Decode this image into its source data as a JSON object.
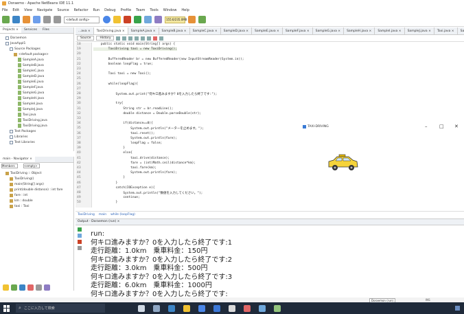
{
  "window": {
    "title": "Doraemo - Apache NetBeans IDE 11.1"
  },
  "menu": [
    "File",
    "Edit",
    "View",
    "Navigate",
    "Source",
    "Refactor",
    "Run",
    "Debug",
    "Profile",
    "Team",
    "Tools",
    "Window",
    "Help"
  ],
  "toolbar": {
    "config": "<default config>",
    "memory": "155.6/235.0MB"
  },
  "projects_panel": {
    "tabs": [
      "Projects ×",
      "Services",
      "Files"
    ],
    "tree": [
      {
        "label": "Doraemon",
        "indent": 1,
        "kind": "box"
      },
      {
        "label": "JavaAppl1",
        "indent": 1,
        "kind": "box"
      },
      {
        "label": "Source Packages",
        "indent": 2,
        "kind": "box"
      },
      {
        "label": "<default package>",
        "indent": 3,
        "kind": "pkg"
      },
      {
        "label": "SampleA.java",
        "indent": 4,
        "kind": "file"
      },
      {
        "label": "SampleB.java",
        "indent": 4,
        "kind": "file"
      },
      {
        "label": "SampleC.java",
        "indent": 4,
        "kind": "file"
      },
      {
        "label": "SampleD.java",
        "indent": 4,
        "kind": "file"
      },
      {
        "label": "SampleE.java",
        "indent": 4,
        "kind": "file"
      },
      {
        "label": "SampleF.java",
        "indent": 4,
        "kind": "file"
      },
      {
        "label": "SampleG.java",
        "indent": 4,
        "kind": "file"
      },
      {
        "label": "SampleH.java",
        "indent": 4,
        "kind": "file"
      },
      {
        "label": "SampleI.java",
        "indent": 4,
        "kind": "file"
      },
      {
        "label": "SampleJ.java",
        "indent": 4,
        "kind": "file"
      },
      {
        "label": "Taxi.java",
        "indent": 4,
        "kind": "file"
      },
      {
        "label": "TaxiDriving.java",
        "indent": 4,
        "kind": "file"
      },
      {
        "label": "TaxiDriving.java",
        "indent": 4,
        "kind": "file"
      },
      {
        "label": "Test Packages",
        "indent": 2,
        "kind": "box"
      },
      {
        "label": "Libraries",
        "indent": 2,
        "kind": "box"
      },
      {
        "label": "Test Libraries",
        "indent": 2,
        "kind": "box"
      }
    ]
  },
  "navigator_panel": {
    "title": "main - Navigator ×",
    "members_label": "Members",
    "filter": "<empty>",
    "items": [
      {
        "label": "TaxiDriving :: Object",
        "indent": 1
      },
      {
        "label": "TaxiDriving()",
        "indent": 2
      },
      {
        "label": "main(String[] args)",
        "indent": 2
      },
      {
        "label": "print(double distance) : int fare",
        "indent": 2
      },
      {
        "label": "fare : int",
        "indent": 2
      },
      {
        "label": "km : double",
        "indent": 2
      },
      {
        "label": "taxi : Taxi",
        "indent": 2
      }
    ]
  },
  "editor": {
    "tabs": [
      "...ava ×",
      "TaxiDriving.java ×",
      "SampleA.java ×",
      "SampleB.java ×",
      "SampleC.java ×",
      "SampleD.java ×",
      "SampleE.java ×",
      "SampleF.java ×",
      "SampleG.java ×",
      "SampleH.java ×",
      "SampleI.java ×",
      "SampleJ.java ×",
      "Taxi.java ×",
      "SampleK.java ×",
      "Sample"
    ],
    "source_btn": "Source",
    "history_btn": "History",
    "line_numbers": [
      "18",
      "19",
      "20",
      "21",
      "22",
      "23",
      "24",
      "25",
      "26",
      "27",
      "28",
      "29",
      "30",
      "31",
      "32",
      "33",
      "34",
      "35",
      "36",
      "37",
      "38",
      "39",
      "40",
      "41",
      "42",
      "43",
      "44",
      "45",
      "46",
      "47",
      "48",
      "49",
      "50"
    ],
    "lines": [
      "    public static void main(String[] args) {",
      "        TaxiDriving taxi = new TaxiDriving();",
      "",
      "        BufferedReader br = new BufferedReader(new InputStreamReader(System.in));",
      "        boolean loopFlag = true;",
      "",
      "        Taxi taxi = new Taxi();",
      "",
      "        while(loopFlag){",
      "",
      "            System.out.print(\"何キロ進みますか？0を入力したら終了です:\");",
      "",
      "            try{",
      "                String str = br.readLine();",
      "                double distance = Double.parseDouble(str);",
      "",
      "                if(distance==0){",
      "                    System.out.println(\"メーターを止めます。\");",
      "                    taxi.reset();",
      "                    System.out.println(fare);",
      "                    loopFlag = false;",
      "                }",
      "                else{",
      "                    taxi.drive(distance);",
      "                    fare = (int)Math.ceil(distance*km);",
      "                    taxi.fare(km);",
      "                    System.out.println(fare);",
      "                }",
      "            }",
      "            catch(IOException e){",
      "                System.out.println(\"数値を入力してください。\");",
      "                continue;",
      "            }"
    ]
  },
  "app_window": {
    "title": "TAXI-DRIVING"
  },
  "breadcrumb": [
    "TaxiDriving",
    "main",
    "while (loopFlag)"
  ],
  "output": {
    "tab_label": "Output - Doraemon (run) ×",
    "lines": [
      "run:",
      "何キロ進みますか？0を入力したら終了です:1",
      "走行距離：1.0km　乗車料金：150円",
      "何キロ進みますか？0を入力したら終了です:2",
      "走行距離：3.0km　乗車料金：500円",
      "何キロ進みますか？0を入力したら終了です:3",
      "走行距離：6.0km　乗車料金：1000円",
      "何キロ進みますか？0を入力したら終了です:"
    ]
  },
  "status": {
    "position": "Doraemon (run)",
    "mode": "INS"
  },
  "taskbar": {
    "search_placeholder": "ここに入力して検索"
  },
  "colors": {
    "accent": "#f5d33a",
    "taskbar": "#1f2a3a",
    "highlight": "#e9efe3"
  }
}
